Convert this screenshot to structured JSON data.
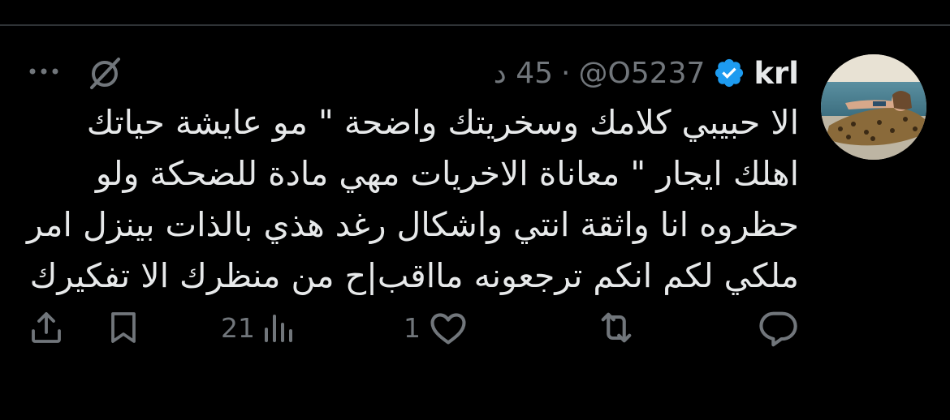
{
  "tweet": {
    "author": {
      "display_name": "krl",
      "handle": "@O5237",
      "verified": true
    },
    "separator": "·",
    "time_ago": "45 د",
    "text_lines": [
      "الا حبيبي كلامك وسخريتك واضحة \" مو عايشة حياتك",
      "اهلك ايجار \" معاناة الاخريات مهي مادة للضحكة ولو",
      "حظروه انا واثقة انتي واشكال رغد هذي بالذات بينزل امر",
      "ملكي لكم انكم ترجعونه مااقب|ح من منظرك الا تفكيرك"
    ],
    "stats": {
      "replies": "",
      "retweets": "",
      "likes": "1",
      "views": "21"
    }
  },
  "colors": {
    "background": "#000000",
    "text_primary": "#e7e9ea",
    "text_secondary": "#71767b",
    "verified_blue": "#1d9bf0",
    "divider": "#2f3336"
  },
  "icons": {
    "grok": "grok-slash-icon",
    "more": "more-dots-icon",
    "reply": "reply-bubble-icon",
    "retweet": "retweet-arrows-icon",
    "like": "heart-icon",
    "views": "views-bars-icon",
    "bookmark": "bookmark-icon",
    "share": "share-upload-icon"
  }
}
